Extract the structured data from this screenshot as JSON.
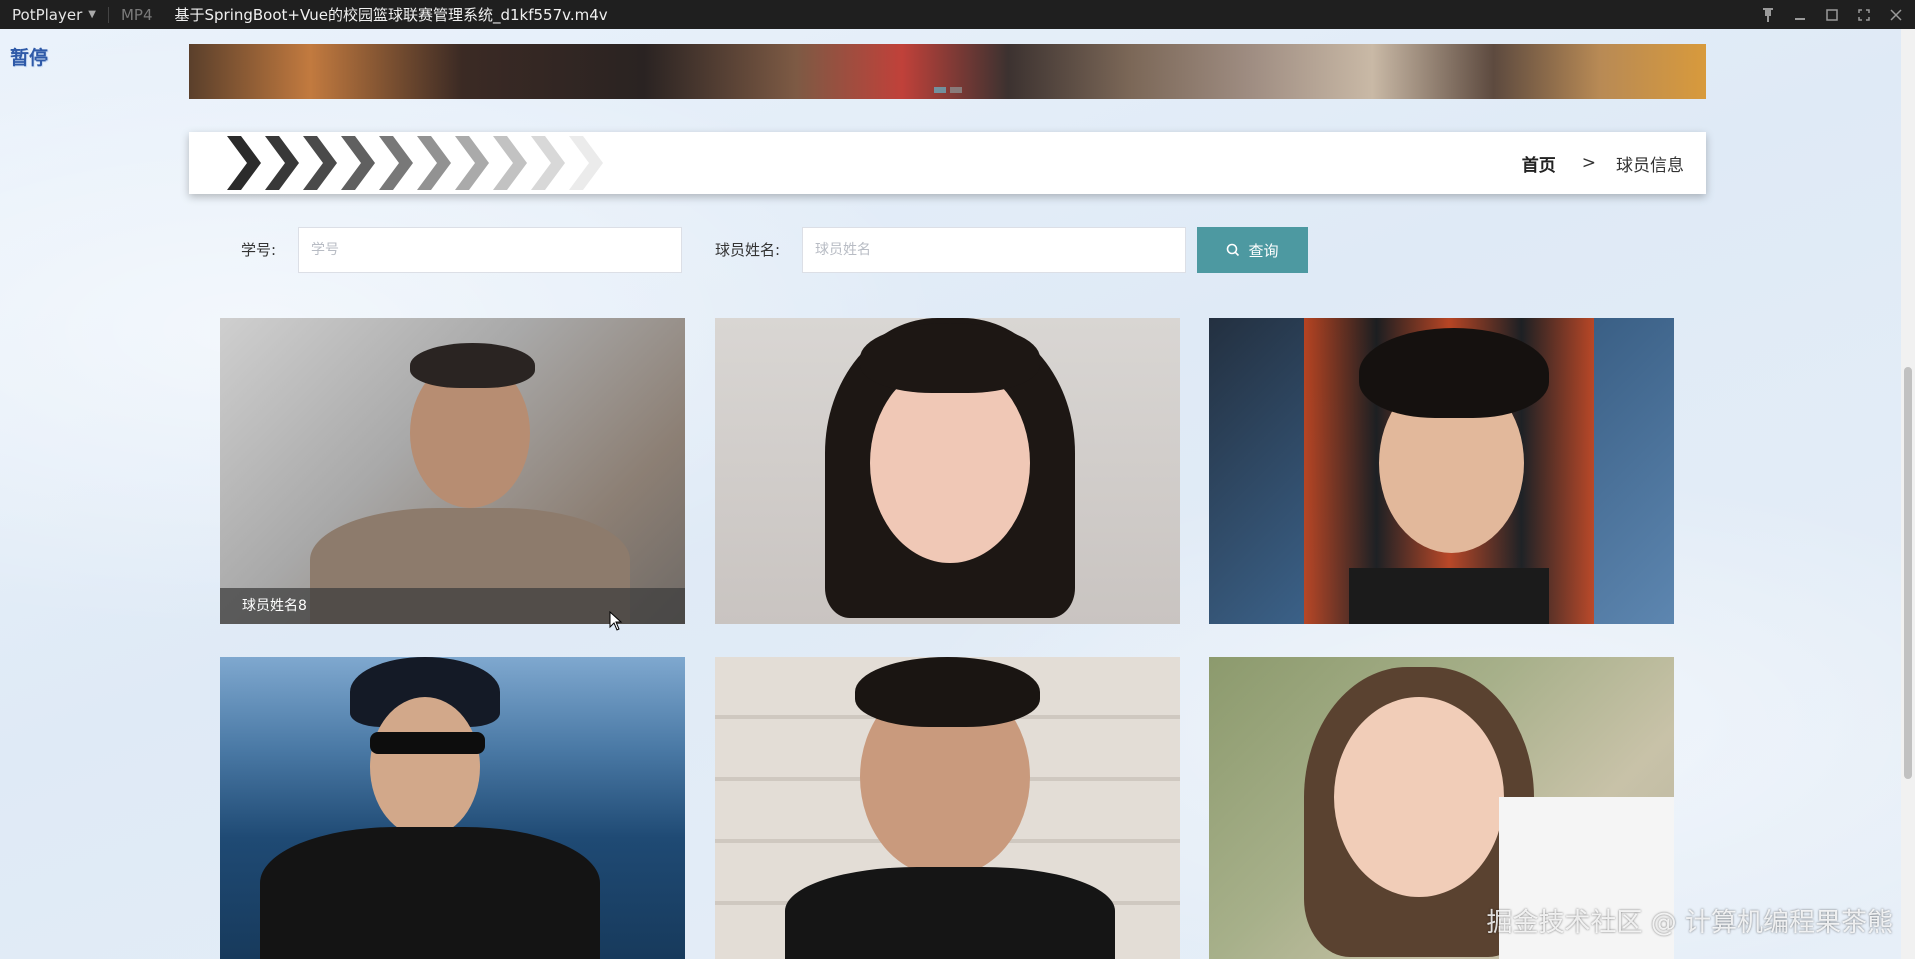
{
  "titlebar": {
    "app_name": "PotPlayer",
    "format": "MP4",
    "file_title": "基于SpringBoot+Vue的校园篮球联赛管理系统_d1kf557v.m4v"
  },
  "overlay": {
    "paused": "暂停",
    "watermark": "掘金技术社区 @ 计算机编程果茶熊"
  },
  "breadcrumb": {
    "home": "首页",
    "separator": ">",
    "current": "球员信息"
  },
  "search": {
    "id_label": "学号:",
    "id_placeholder": "学号",
    "name_label": "球员姓名:",
    "name_placeholder": "球员姓名",
    "button_label": "查询"
  },
  "cards": [
    {
      "caption": "球员姓名8"
    }
  ],
  "colors": {
    "accent": "#4d99a1",
    "titlebar": "#1f1f1f"
  }
}
